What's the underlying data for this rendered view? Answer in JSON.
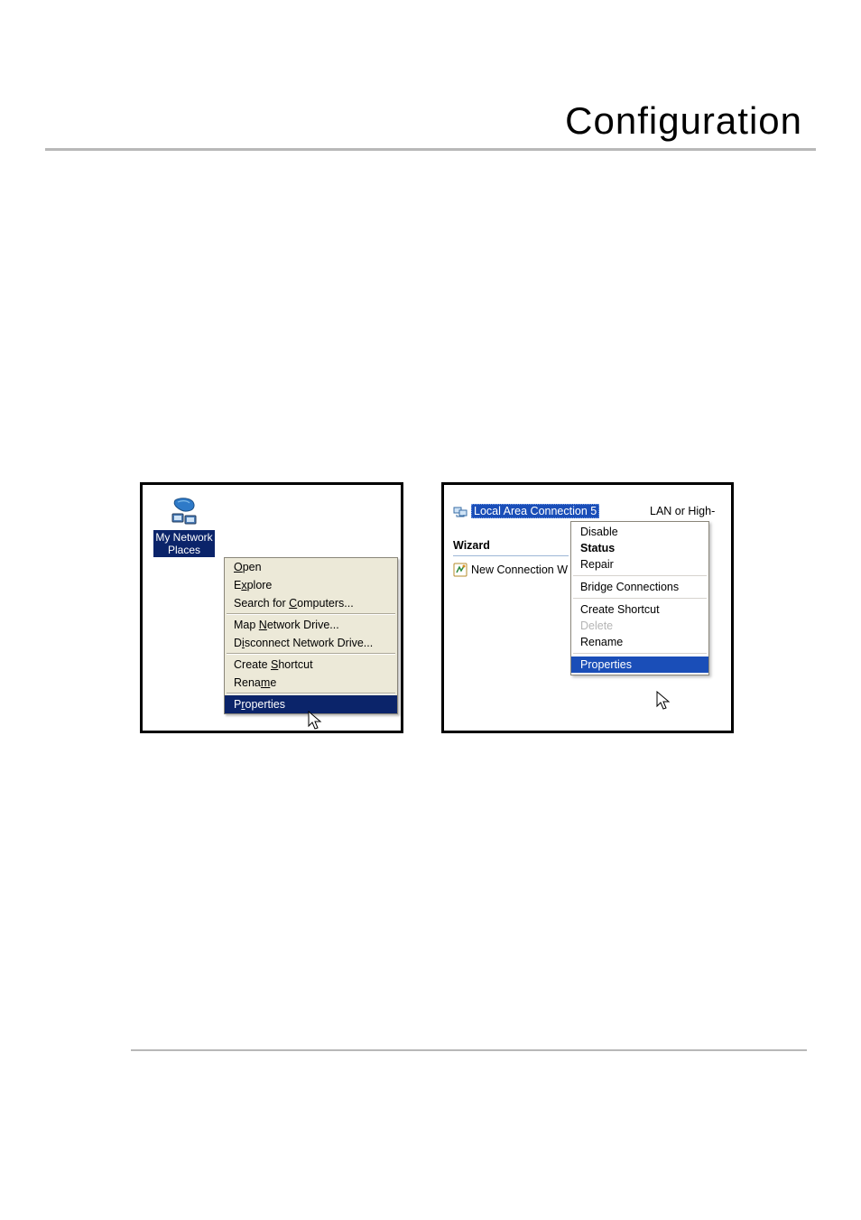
{
  "title": "Configuration",
  "left": {
    "icon_label_line1": "My Network",
    "icon_label_line2": "Places",
    "menu": {
      "open": "Open",
      "explore": "Explore",
      "search": "Search for Computers...",
      "map_drive": "Map Network Drive...",
      "disc_drive": "Disconnect Network Drive...",
      "create_shortcut": "Create Shortcut",
      "rename": "Rename",
      "properties": "Properties"
    }
  },
  "right": {
    "lac_label": "Local Area Connection 5",
    "lac_type": "LAN or High-",
    "wizard_group": "Wizard",
    "new_conn": "New Connection W",
    "menu": {
      "disable": "Disable",
      "status": "Status",
      "repair": "Repair",
      "bridge": "Bridge Connections",
      "create_shortcut": "Create Shortcut",
      "delete": "Delete",
      "rename": "Rename",
      "properties": "Properties"
    }
  }
}
